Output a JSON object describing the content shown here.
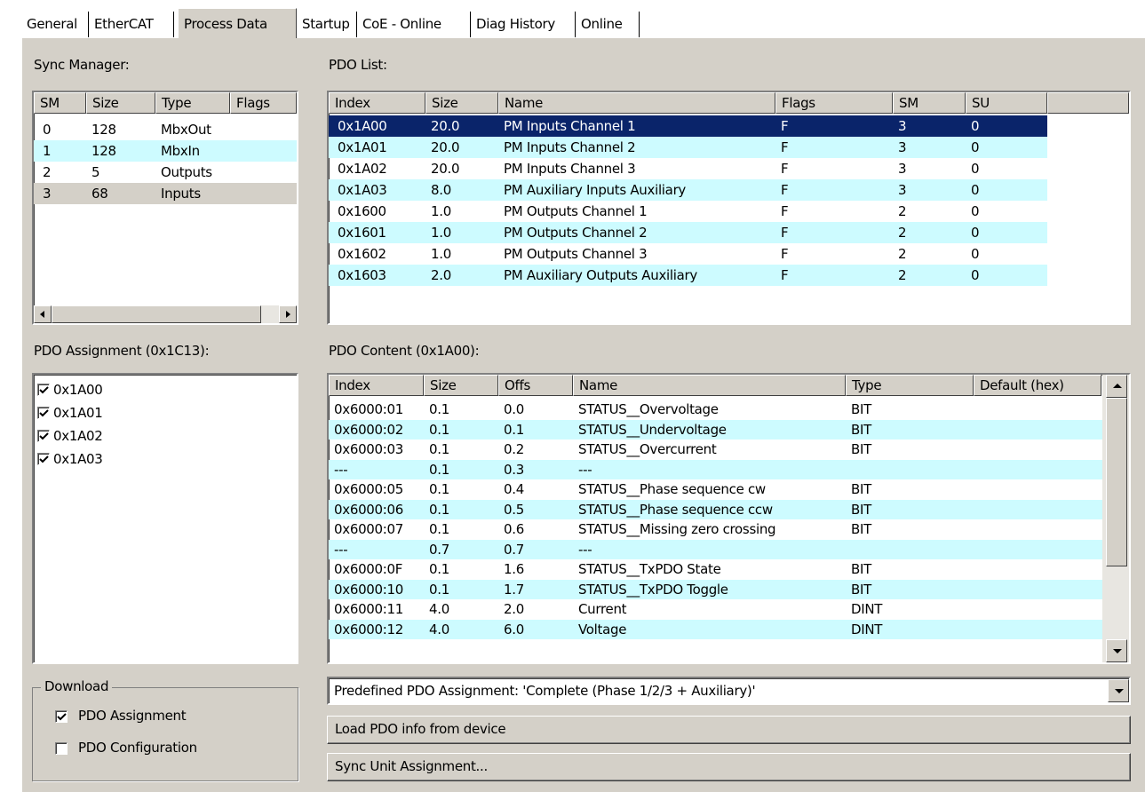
{
  "tabs": [
    "General",
    "EtherCAT",
    "Process Data",
    "Startup",
    "CoE - Online",
    "Diag History",
    "Online"
  ],
  "sync_manager": {
    "label": "Sync Manager:",
    "headers": [
      "SM",
      "Size",
      "Type",
      "Flags"
    ],
    "rows": [
      [
        "0",
        "128",
        "MbxOut",
        ""
      ],
      [
        "1",
        "128",
        "MbxIn",
        ""
      ],
      [
        "2",
        "5",
        "Outputs",
        ""
      ],
      [
        "3",
        "68",
        "Inputs",
        ""
      ]
    ]
  },
  "pdo_list": {
    "label": "PDO List:",
    "headers": [
      "Index",
      "Size",
      "Name",
      "Flags",
      "SM",
      "SU"
    ],
    "rows": [
      [
        "0x1A00",
        "20.0",
        "PM Inputs Channel 1",
        "F",
        "3",
        "0"
      ],
      [
        "0x1A01",
        "20.0",
        "PM Inputs Channel 2",
        "F",
        "3",
        "0"
      ],
      [
        "0x1A02",
        "20.0",
        "PM Inputs Channel 3",
        "F",
        "3",
        "0"
      ],
      [
        "0x1A03",
        "8.0",
        "PM Auxiliary Inputs Auxiliary",
        "F",
        "3",
        "0"
      ],
      [
        "0x1600",
        "1.0",
        "PM Outputs Channel 1",
        "F",
        "2",
        "0"
      ],
      [
        "0x1601",
        "1.0",
        "PM Outputs Channel 2",
        "F",
        "2",
        "0"
      ],
      [
        "0x1602",
        "1.0",
        "PM Outputs Channel 3",
        "F",
        "2",
        "0"
      ],
      [
        "0x1603",
        "2.0",
        "PM Auxiliary Outputs Auxiliary",
        "F",
        "2",
        "0"
      ]
    ]
  },
  "pdo_assignment": {
    "label": "PDO Assignment (0x1C13):",
    "items": [
      "0x1A00",
      "0x1A01",
      "0x1A02",
      "0x1A03"
    ]
  },
  "pdo_content": {
    "label": "PDO Content (0x1A00):",
    "headers": [
      "Index",
      "Size",
      "Offs",
      "Name",
      "Type",
      "Default (hex)"
    ],
    "rows": [
      [
        "0x6000:01",
        "0.1",
        "0.0",
        "STATUS__Overvoltage",
        "BIT"
      ],
      [
        "0x6000:02",
        "0.1",
        "0.1",
        "STATUS__Undervoltage",
        "BIT"
      ],
      [
        "0x6000:03",
        "0.1",
        "0.2",
        "STATUS__Overcurrent",
        "BIT"
      ],
      [
        "---",
        "0.1",
        "0.3",
        "---",
        ""
      ],
      [
        "0x6000:05",
        "0.1",
        "0.4",
        "STATUS__Phase sequence cw",
        "BIT"
      ],
      [
        "0x6000:06",
        "0.1",
        "0.5",
        "STATUS__Phase sequence ccw",
        "BIT"
      ],
      [
        "0x6000:07",
        "0.1",
        "0.6",
        "STATUS__Missing zero crossing",
        "BIT"
      ],
      [
        "---",
        "0.7",
        "0.7",
        "---",
        ""
      ],
      [
        "0x6000:0F",
        "0.1",
        "1.6",
        "STATUS__TxPDO State",
        "BIT"
      ],
      [
        "0x6000:10",
        "0.1",
        "1.7",
        "STATUS__TxPDO Toggle",
        "BIT"
      ],
      [
        "0x6000:11",
        "4.0",
        "2.0",
        "Current",
        "DINT"
      ],
      [
        "0x6000:12",
        "4.0",
        "6.0",
        "Voltage",
        "DINT"
      ]
    ]
  },
  "download": {
    "label": "Download",
    "pdo_assignment": "PDO Assignment",
    "pdo_configuration": "PDO Configuration"
  },
  "predefined": "Predefined PDO Assignment: 'Complete (Phase 1/2/3 + Auxiliary)'",
  "load_button": "Load PDO info from device",
  "sync_unit_button": "Sync Unit Assignment...",
  "colors": {
    "alt_row": "#cdfbff",
    "selection": "#0a246a",
    "face": "#d4d0c8"
  }
}
